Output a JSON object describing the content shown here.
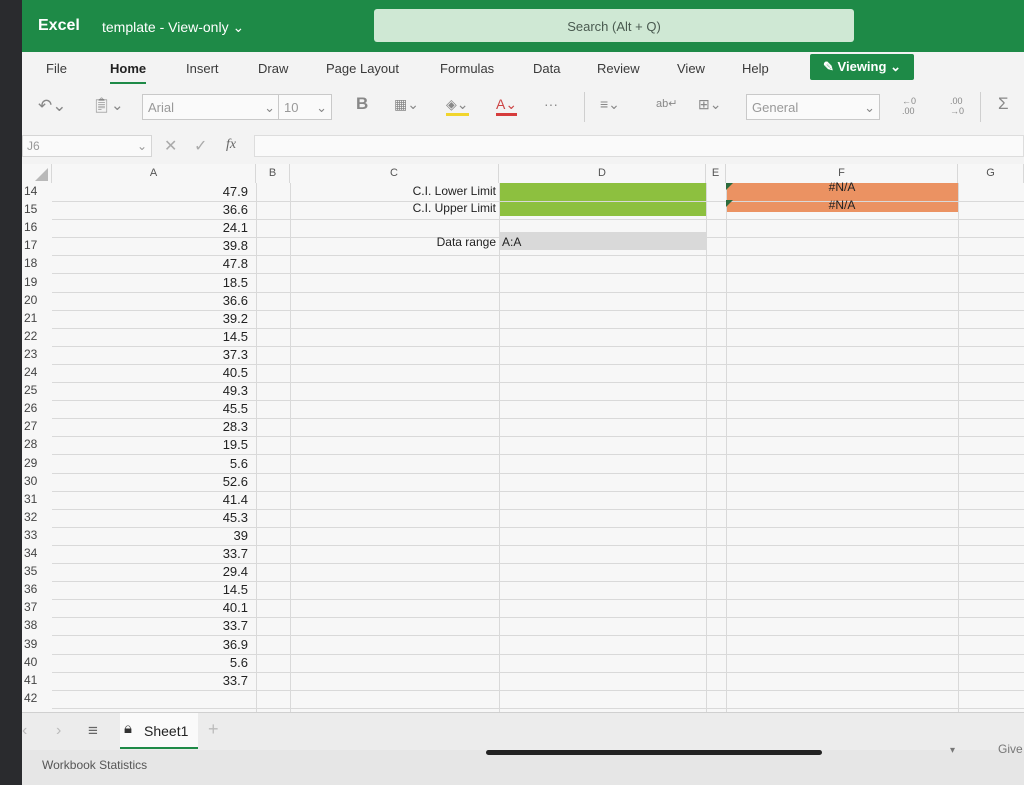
{
  "title_bar": {
    "app_name": "Excel",
    "doc_title": "template - View-only ⌄",
    "search_placeholder": "Search (Alt + Q)"
  },
  "ribbon": {
    "tabs": [
      "File",
      "Home",
      "Insert",
      "Draw",
      "Page Layout",
      "Formulas",
      "Data",
      "Review",
      "View",
      "Help"
    ],
    "active_tab": "Home",
    "mode_button": "Viewing"
  },
  "toolbar": {
    "font_name": "Arial",
    "font_size": "10",
    "bold_label": "B",
    "number_format": "General",
    "increase_decimal": "←0\n.00",
    "decrease_decimal": ".00\n→0",
    "sum_label": "Σ"
  },
  "formula_bar": {
    "name_box": "J6",
    "fx_label": "fx",
    "value": ""
  },
  "grid": {
    "columns": [
      "A",
      "B",
      "C",
      "D",
      "E",
      "F",
      "G"
    ],
    "rows": [
      {
        "num": "14",
        "a": "47.9"
      },
      {
        "num": "15",
        "a": "36.6"
      },
      {
        "num": "16",
        "a": "24.1"
      },
      {
        "num": "17",
        "a": "39.8"
      },
      {
        "num": "18",
        "a": "47.8"
      },
      {
        "num": "19",
        "a": "18.5"
      },
      {
        "num": "20",
        "a": "36.6"
      },
      {
        "num": "21",
        "a": "39.2"
      },
      {
        "num": "22",
        "a": "14.5"
      },
      {
        "num": "23",
        "a": "37.3"
      },
      {
        "num": "24",
        "a": "40.5"
      },
      {
        "num": "25",
        "a": "49.3"
      },
      {
        "num": "26",
        "a": "45.5"
      },
      {
        "num": "27",
        "a": "28.3"
      },
      {
        "num": "28",
        "a": "19.5"
      },
      {
        "num": "29",
        "a": "5.6"
      },
      {
        "num": "30",
        "a": "52.6"
      },
      {
        "num": "31",
        "a": "41.4"
      },
      {
        "num": "32",
        "a": "45.3"
      },
      {
        "num": "33",
        "a": "39"
      },
      {
        "num": "34",
        "a": "33.7"
      },
      {
        "num": "35",
        "a": "29.4"
      },
      {
        "num": "36",
        "a": "14.5"
      },
      {
        "num": "37",
        "a": "40.1"
      },
      {
        "num": "38",
        "a": "33.7"
      },
      {
        "num": "39",
        "a": "36.9"
      },
      {
        "num": "40",
        "a": "5.6"
      },
      {
        "num": "41",
        "a": "33.7"
      },
      {
        "num": "42",
        "a": ""
      }
    ],
    "labels": {
      "ci_lower": "C.I. Lower Limit",
      "ci_upper": "C.I. Upper Limit",
      "data_range_label": "Data range",
      "data_range_value": "A:A"
    },
    "f_values": [
      "#N/A",
      "#N/A"
    ],
    "colors": {
      "green_fill": "#8dc03f",
      "orange_fill": "#eb9262",
      "gray_fill": "#d9d9d9"
    }
  },
  "sheet_tabs": {
    "active_sheet": "Sheet1",
    "add_label": "+"
  },
  "status_bar": {
    "left": "Workbook Statistics",
    "right": "Give"
  }
}
